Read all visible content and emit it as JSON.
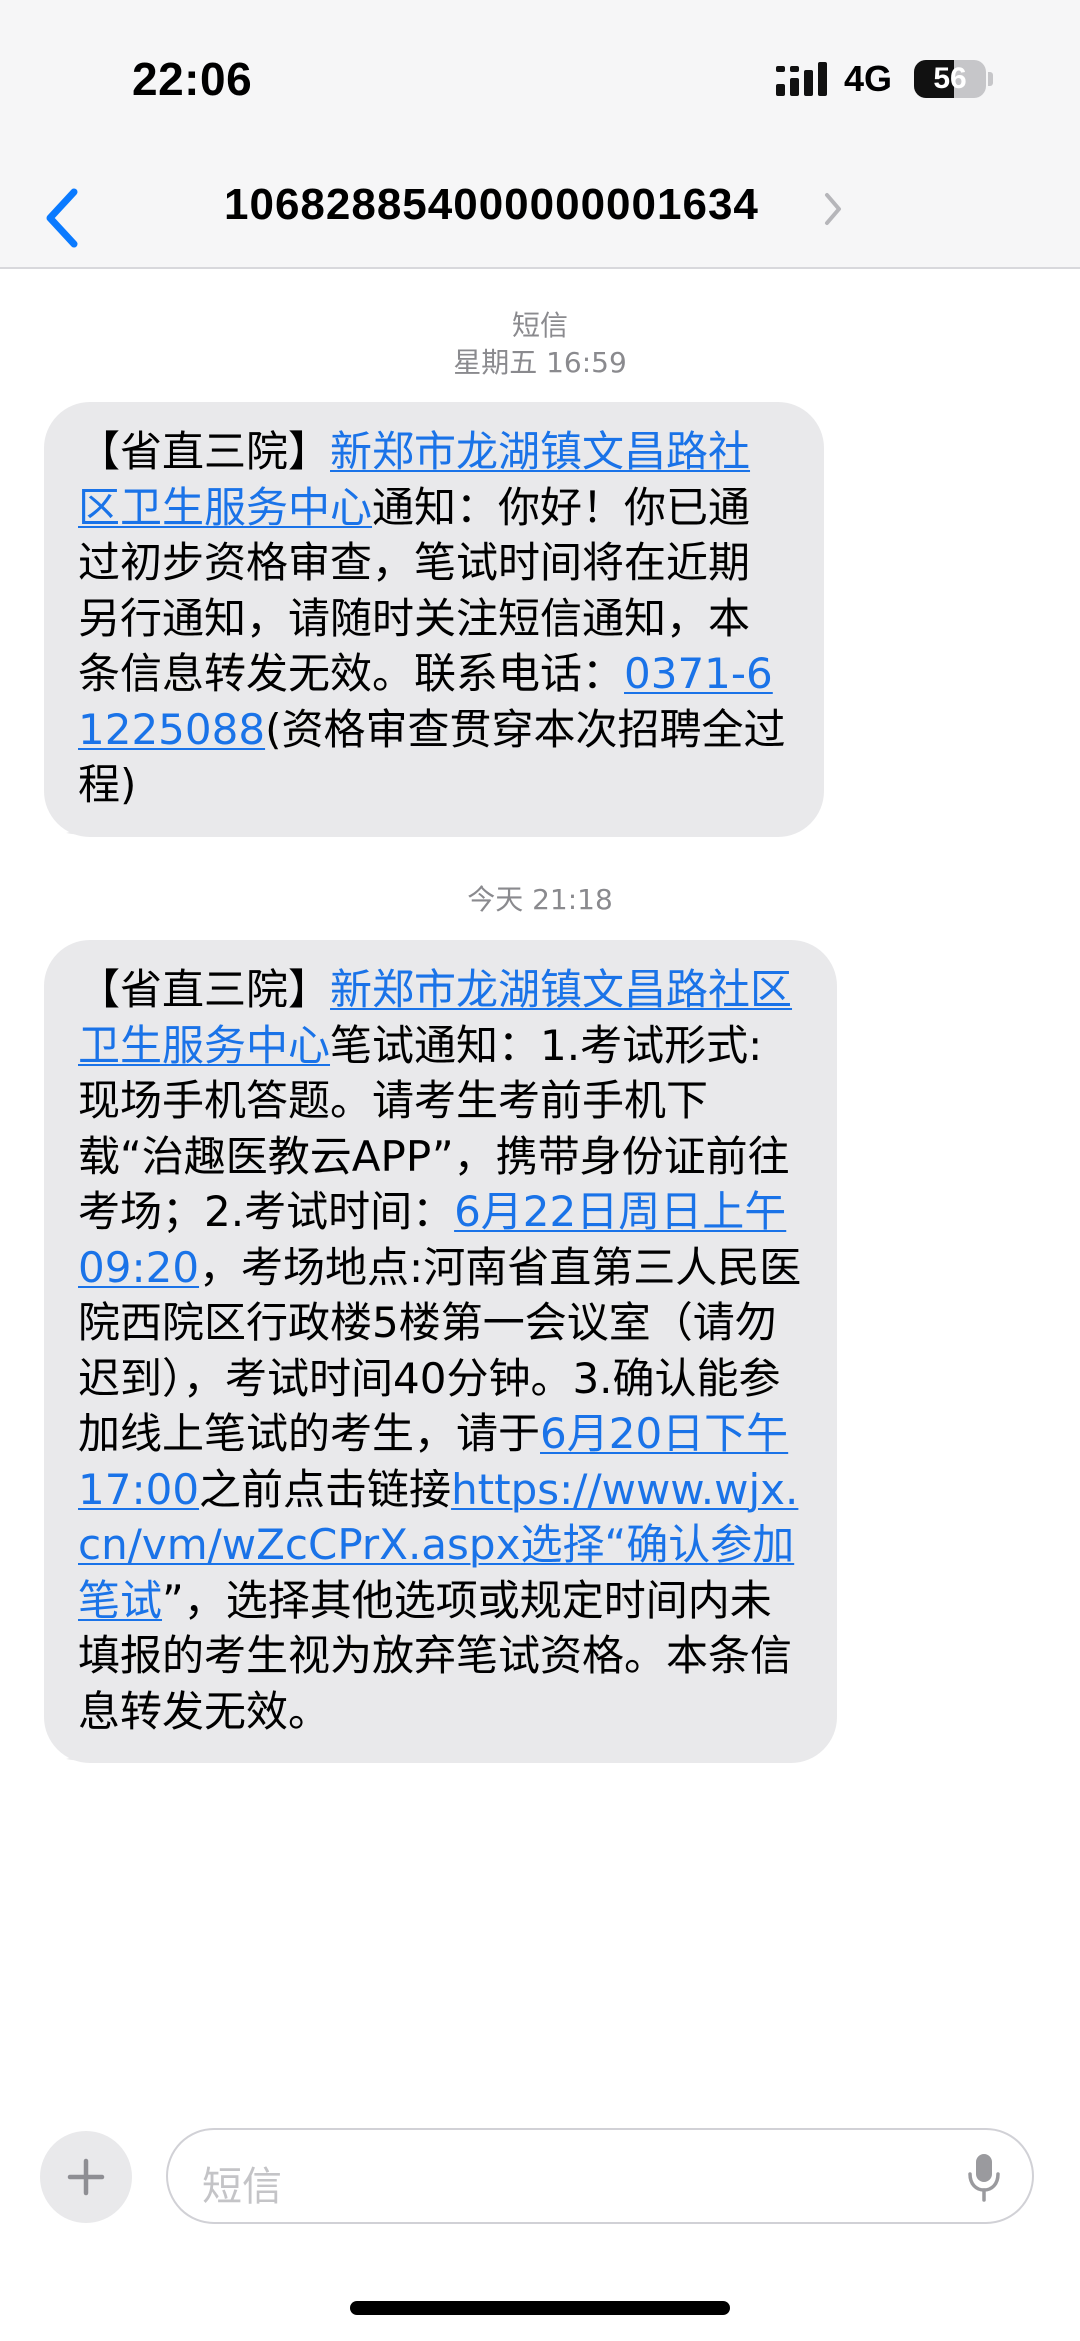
{
  "status_bar": {
    "time": "22:06",
    "network": "4G",
    "battery": "56",
    "battery_level": 0.56
  },
  "nav": {
    "title": "106828854000000001634",
    "back_icon": "chevron-left-icon",
    "detail_icon": "chevron-right-icon"
  },
  "conversation": {
    "service_label": "短信",
    "messages": [
      {
        "timestamp": "星期五 16:59",
        "segments": [
          {
            "text": "【省直三院】",
            "link": false
          },
          {
            "text": "新郑市龙湖镇文昌路社区卫生服务中心",
            "link": true
          },
          {
            "text": "通知：你好！你已通过初步资格审查，笔试时间将在近期另行通知，请随时关注短信通知，本条信息转发无效。联系电话：",
            "link": false
          },
          {
            "text": "0371-61225088",
            "link": true
          },
          {
            "text": "(资格审查贯穿本次招聘全过程)",
            "link": false
          }
        ]
      },
      {
        "timestamp": "今天 21:18",
        "segments": [
          {
            "text": "【省直三院】",
            "link": false
          },
          {
            "text": "新郑市龙湖镇文昌路社区卫生服务中心",
            "link": true
          },
          {
            "text": "笔试通知：1.考试形式:现场手机答题。请考生考前手机下载“治趣医教云APP”，携带身份证前往考场；2.考试时间：",
            "link": false
          },
          {
            "text": "6月22日周日上午09:20",
            "link": true
          },
          {
            "text": "，考场地点:河南省直第三人民医院西院区行政楼5楼第一会议室（请勿迟到），考试时间40分钟。3.确认能参加线上笔试的考生，请于",
            "link": false
          },
          {
            "text": "6月20日下午17:00",
            "link": true
          },
          {
            "text": "之前点击链接",
            "link": false
          },
          {
            "text": "https://www.wjx.cn/vm/wZcCPrX.aspx",
            "link": true
          },
          {
            "text": "选择“确认参加笔试",
            "link": true
          },
          {
            "text": "”，选择其他选项或规定时间内未填报的考生视为放弃笔试资格。本条信息转发无效。",
            "link": false
          }
        ]
      }
    ]
  },
  "composer": {
    "placeholder": "短信",
    "add_icon": "plus-icon",
    "mic_icon": "microphone-icon"
  },
  "colors": {
    "link": "#1a73e8",
    "back_accent": "#0a7aff",
    "bubble_bg": "#e9e9eb",
    "secondary_text": "#8a8a8e"
  }
}
